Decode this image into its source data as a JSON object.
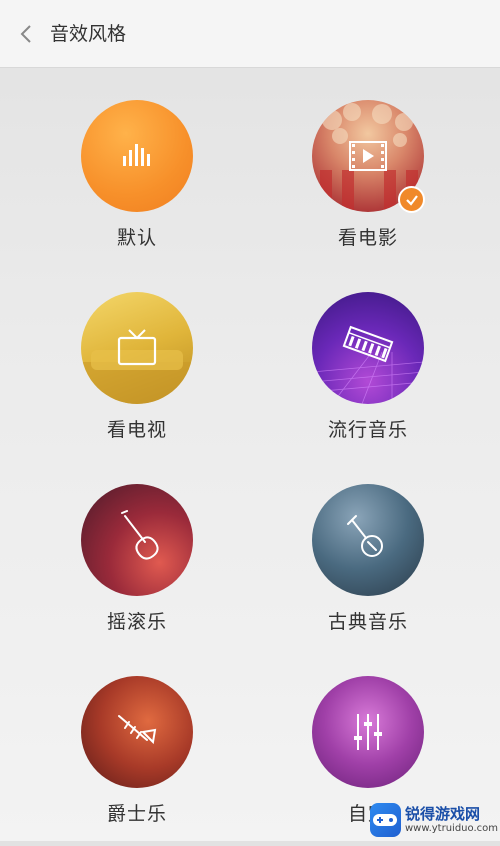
{
  "header": {
    "title": "音效风格",
    "back_icon": "chevron-left-icon"
  },
  "styles": [
    {
      "label": "默认",
      "icon": "equalizer-bars-icon",
      "selected": false
    },
    {
      "label": "看电影",
      "icon": "film-play-icon",
      "selected": true
    },
    {
      "label": "看电视",
      "icon": "tv-icon",
      "selected": false
    },
    {
      "label": "流行音乐",
      "icon": "keyboard-icon",
      "selected": false
    },
    {
      "label": "摇滚乐",
      "icon": "electric-guitar-icon",
      "selected": false
    },
    {
      "label": "古典音乐",
      "icon": "banjo-icon",
      "selected": false
    },
    {
      "label": "爵士乐",
      "icon": "trumpet-icon",
      "selected": false
    },
    {
      "label": "自定",
      "icon": "mixer-sliders-icon",
      "selected": false
    }
  ],
  "selected_icon": "checkmark-icon",
  "colors": {
    "accent": "#f0892a",
    "text": "#333333"
  },
  "watermark": {
    "title": "锐得游戏网",
    "url": "www.ytruiduo.com"
  }
}
